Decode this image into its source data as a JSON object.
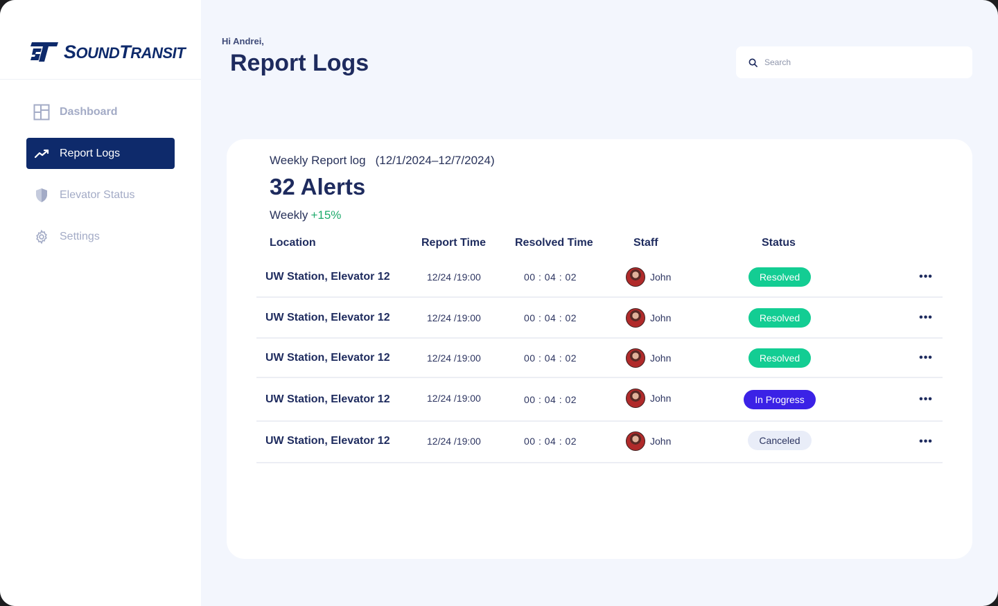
{
  "brand": {
    "logo_text_prefix": "S",
    "logo_text_middle": "OUND",
    "logo_text_t": "T",
    "logo_text_suffix": "RANSIT",
    "color": "#0e2a6b"
  },
  "sidebar": {
    "items": [
      {
        "label": "Dashboard",
        "icon": "dashboard-grid-icon",
        "active": false
      },
      {
        "label": "Report Logs",
        "icon": "trend-chart-icon",
        "active": true
      },
      {
        "label": "Elevator Status",
        "icon": "shield-icon",
        "active": false
      },
      {
        "label": "Settings",
        "icon": "gear-icon",
        "active": false
      }
    ]
  },
  "header": {
    "greeting": "Hi Andrei,",
    "title": "Report Logs",
    "search_placeholder": "Search"
  },
  "card": {
    "subtitle": "Weekly Report log",
    "range": "(12/1/2024–12/7/2024)",
    "alerts": "32 Alerts",
    "weekly_label": "Weekly",
    "weekly_delta": "+15%"
  },
  "table": {
    "headers": {
      "location": "Location",
      "report_time": "Report Time",
      "resolved_time": "Resolved Time",
      "staff": "Staff",
      "status": "Status"
    },
    "rows": [
      {
        "location": "UW Station, Elevator 12",
        "report_time": "12/24 /19:00",
        "resolved_time": "00 : 04 : 02",
        "staff": "John",
        "status": "Resolved"
      },
      {
        "location": "UW Station, Elevator 12",
        "report_time": "12/24 /19:00",
        "resolved_time": "00 : 04 : 02",
        "staff": "John",
        "status": "Resolved"
      },
      {
        "location": "UW Station, Elevator 12",
        "report_time": "12/24 /19:00",
        "resolved_time": "00 : 04 : 02",
        "staff": "John",
        "status": "Resolved"
      },
      {
        "location": "UW Station, Elevator 12",
        "report_time": "12/24 /19:00",
        "resolved_time": "00 : 04 : 02",
        "staff": "John",
        "status": "In Progress"
      },
      {
        "location": "UW Station, Elevator 12",
        "report_time": "12/24 /19:00",
        "resolved_time": "00 : 04 : 02",
        "staff": "John",
        "status": "Canceled"
      }
    ],
    "more_icon": "more-horizontal-icon"
  },
  "colors": {
    "resolved": "#13cd93",
    "in_progress": "#3b22e6",
    "canceled": "#e9edf8",
    "positive": "#1daa6b"
  }
}
